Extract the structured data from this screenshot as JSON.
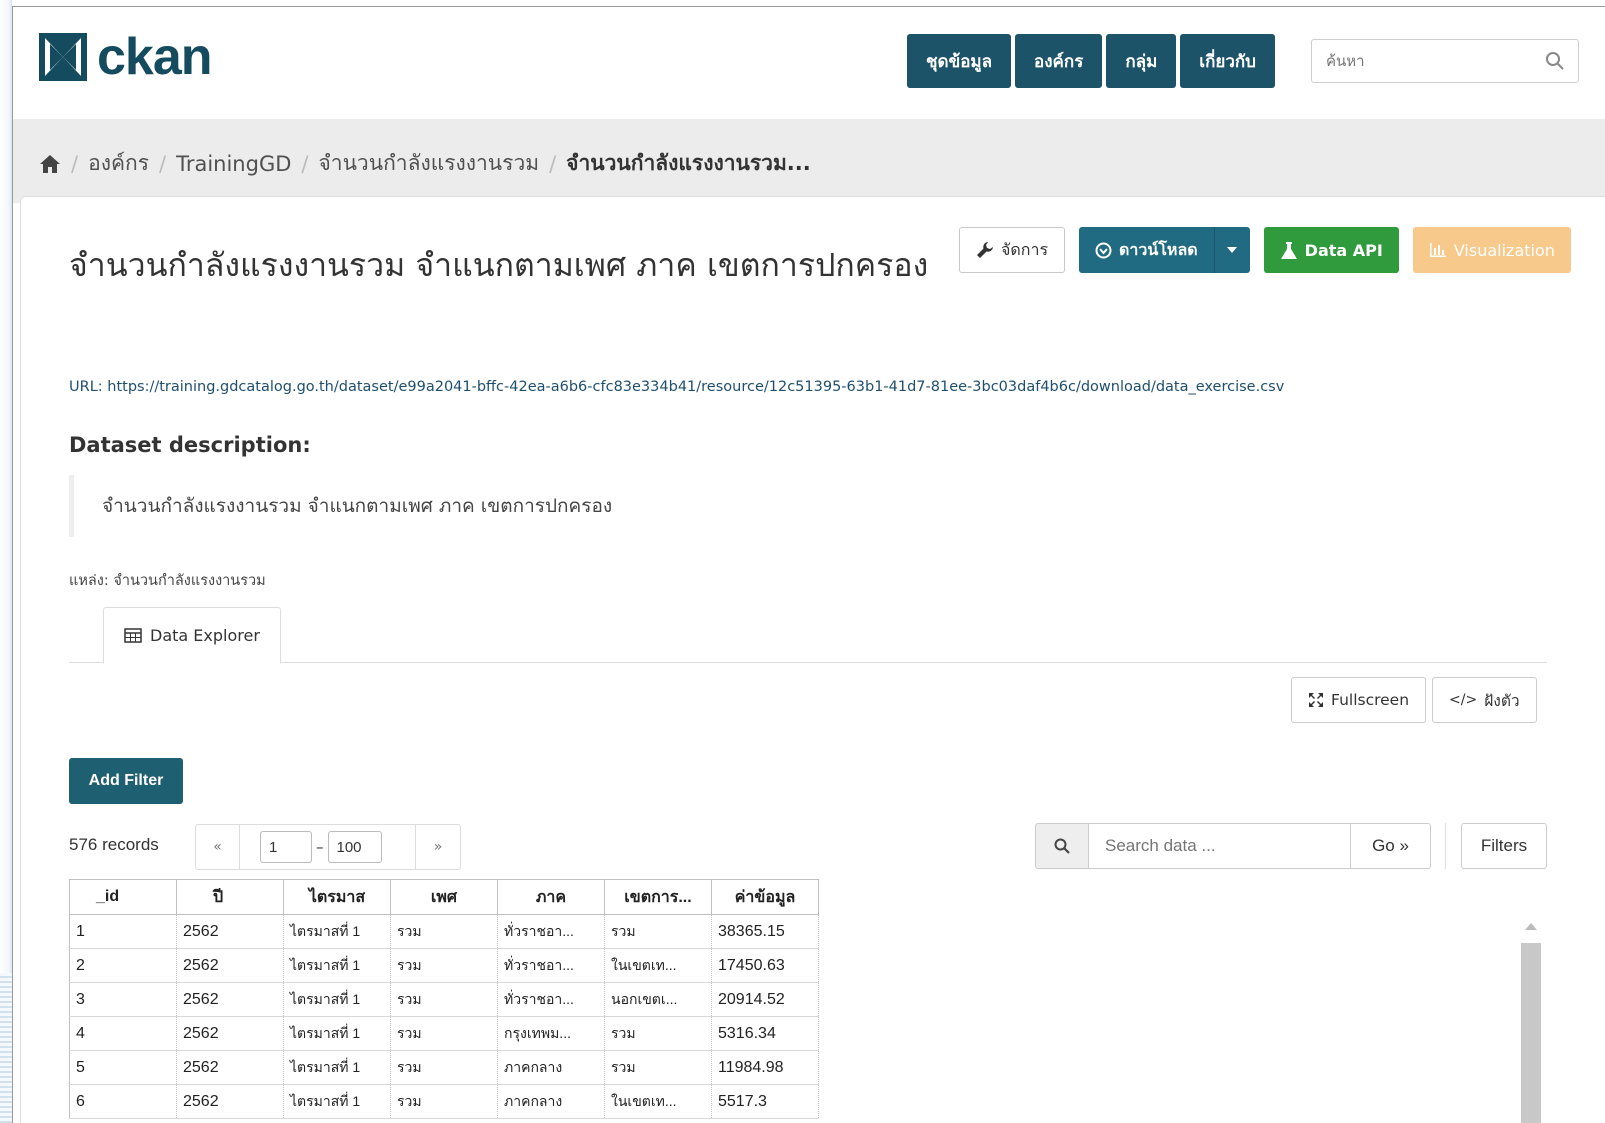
{
  "header": {
    "logo_text": "ckan",
    "nav": [
      "ชุดข้อมูล",
      "องค์กร",
      "กลุ่ม",
      "เกี่ยวกับ"
    ],
    "search_placeholder": "ค้นหา"
  },
  "breadcrumb": {
    "items": [
      "องค์กร",
      "TrainingGD",
      "จำนวนกำลังแรงงานรวม"
    ],
    "current": "จำนวนกำลังแรงงานรวม..."
  },
  "resource": {
    "title": "จำนวนกำลังแรงงานรวม จำแนกตามเพศ ภาค เขตการปกครอง",
    "url_text": "URL: https://training.gdcatalog.go.th/dataset/e99a2041-bffc-42ea-a6b6-cfc83e334b41/resource/12c51395-63b1-41d7-81ee-3bc03daf4b6c/download/data_exercise.csv",
    "description_heading": "Dataset description:",
    "description": "จำนวนกำลังแรงงานรวม จำแนกตามเพศ ภาค เขตการปกครอง",
    "source": "แหล่ง: จำนวนกำลังแรงงานรวม"
  },
  "actions": {
    "manage": "จัดการ",
    "download": "ดาวน์โหลด",
    "data_api": "Data API",
    "visualization": "Visualization"
  },
  "explorer": {
    "tab": "Data Explorer",
    "fullscreen": "Fullscreen",
    "embed": "ฝังตัว",
    "add_filter": "Add Filter",
    "records": "576 records",
    "pager_prev": "«",
    "pager_next": "»",
    "pager_from": "1",
    "pager_to": "100",
    "search_placeholder": "Search data ...",
    "go": "Go »",
    "filters": "Filters"
  },
  "grid": {
    "columns": [
      "_id",
      "ปี",
      "ไตรมาส",
      "เพศ",
      "ภาค",
      "เขตการ...",
      "ค่าข้อมูล"
    ],
    "rows": [
      [
        "1",
        "2562",
        "ไตรมาสที่ 1",
        "รวม",
        "ทั่วราชอา...",
        "รวม",
        "38365.15"
      ],
      [
        "2",
        "2562",
        "ไตรมาสที่ 1",
        "รวม",
        "ทั่วราชอา...",
        "ในเขตเท...",
        "17450.63"
      ],
      [
        "3",
        "2562",
        "ไตรมาสที่ 1",
        "รวม",
        "ทั่วราชอา...",
        "นอกเขตเ...",
        "20914.52"
      ],
      [
        "4",
        "2562",
        "ไตรมาสที่ 1",
        "รวม",
        "กรุงเทพม...",
        "รวม",
        "5316.34"
      ],
      [
        "5",
        "2562",
        "ไตรมาสที่ 1",
        "รวม",
        "ภาคกลาง",
        "รวม",
        "11984.98"
      ],
      [
        "6",
        "2562",
        "ไตรมาสที่ 1",
        "รวม",
        "ภาคกลาง",
        "ในเขตเท...",
        "5517.3"
      ]
    ]
  },
  "colors": {
    "nav_bg": "#1c5368",
    "primary": "#206b82",
    "success": "#2f9b3c",
    "warning": "#f7c98a",
    "add_filter": "#1f5f72"
  }
}
